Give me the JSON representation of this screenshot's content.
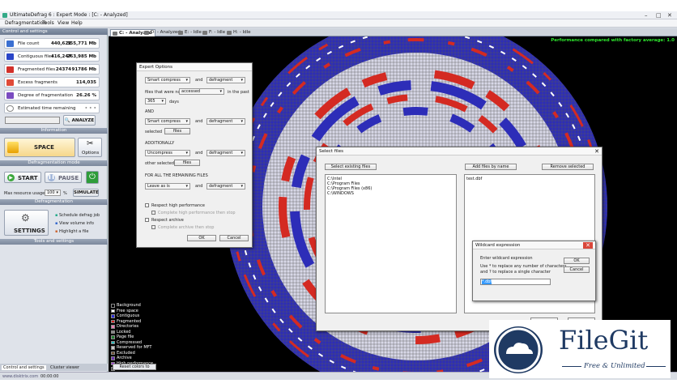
{
  "app": {
    "title": "UltimateDefrag 6  :  Expert Mode  :  [C: - Analyzed]"
  },
  "menu": [
    "Defragmentation",
    "Tools",
    "View",
    "Help"
  ],
  "left": {
    "control_header": "Control and settings",
    "stats": [
      {
        "label": "File count",
        "v1": "440,621",
        "v2": "355,771 Mb",
        "color": "#3a6fd1"
      },
      {
        "label": "Contiguous files",
        "v1": "416,247",
        "v2": "263,985 Mb",
        "color": "#2b46c8"
      },
      {
        "label": "Fragmented files",
        "v1": "24374",
        "v2": "91786 Mb",
        "color": "#d2302a"
      },
      {
        "label": "Excess fragments",
        "v1": "114,035",
        "v2": "",
        "color": "#e04a38"
      },
      {
        "label": "Degree of fragmentation",
        "v1": "26.26 %",
        "v2": "",
        "color": "#7a4bc0"
      }
    ],
    "estimated": "Estimated time remaining",
    "analyze": "ANALYZE",
    "info_footer": "Information",
    "mode_label": "SPACE",
    "options_label": "Options",
    "mode_footer": "Defragmentation mode",
    "start": "START",
    "pause": "PAUSE",
    "max_resource": "Max resource usage:",
    "max_value": "100",
    "pct": "%",
    "simulate": "SIMULATE",
    "defrag_footer": "Defragmentation",
    "settings": "SETTINGS",
    "tools": [
      "Schedule defrag job",
      "View volume info",
      "Highlight a file"
    ],
    "tools_footer": "Tools and settings",
    "bottom_tabs": [
      "Control and settings",
      "Cluster viewer"
    ]
  },
  "tabs": [
    {
      "label": "C: - Analyzed",
      "active": true
    },
    {
      "label": "D: - Analyzed",
      "active": false
    },
    {
      "label": "E: - Idle",
      "active": false
    },
    {
      "label": "F: - Idle",
      "active": false
    },
    {
      "label": "H: - Idle",
      "active": false
    }
  ],
  "perf": "Performance compared with factory average: 1.0",
  "legend": [
    {
      "label": "Background",
      "color": "#000000"
    },
    {
      "label": "Free space",
      "color": "#ffffff"
    },
    {
      "label": "Contiguous",
      "color": "#2b2bd6"
    },
    {
      "label": "Fragmented",
      "color": "#d4221f"
    },
    {
      "label": "Directories",
      "color": "#e87db0"
    },
    {
      "label": "Locked",
      "color": "#888888"
    },
    {
      "label": "Page file",
      "color": "#1d7f2d"
    },
    {
      "label": "Compressed",
      "color": "#27c0c0"
    },
    {
      "label": "Reserved for MFT",
      "color": "#c8c8c8"
    },
    {
      "label": "Excluded",
      "color": "#6b4b2a"
    },
    {
      "label": "Archive",
      "color": "#6b2fb0"
    },
    {
      "label": "High performance",
      "color": "#a33bd8"
    },
    {
      "label": "Interblock space",
      "color": "#3a3a3a"
    }
  ],
  "reset": "Reset colors to default",
  "expert": {
    "title": "Expert Options",
    "s1": "Smart compress",
    "and": "and",
    "s1b": "defragment",
    "notaccessed_pre": "files that were not",
    "notaccessed": "accessed",
    "in_past": "in the past",
    "days_val": "365",
    "days": "days",
    "and_label": "AND",
    "s2": "Smart compress",
    "s2b": "defragment",
    "selected": "selected",
    "files": "files",
    "additionally": "ADDITIONALLY",
    "s3": "Uncompress",
    "s3b": "defragment",
    "other_selected": "other selected",
    "files2": "files",
    "remaining": "FOR ALL THE REMAINING FILES",
    "s4": "Leave as is",
    "s4b": "defragment",
    "respect_hp": "Respect high performance",
    "complete_hp": "Complete high performance then stop",
    "respect_arch": "Respect archive",
    "complete_arch": "Complete archive then stop",
    "ok": "OK",
    "cancel": "Cancel"
  },
  "select": {
    "title": "Select files",
    "select_existing": "Select existing files",
    "add_by_name": "Add files by name",
    "remove": "Remove selected",
    "left_list": [
      "C:\\Intel",
      "C:\\Program Files",
      "C:\\Program Files (x86)",
      "C:\\WINDOWS"
    ],
    "right_list": [
      "test.dbf"
    ]
  },
  "wildcard": {
    "title": "Wildcard expression",
    "prompt": "Enter wildcard expression",
    "hint1": "Use * to replace any number of characters",
    "hint2": "and ? to replace a single character",
    "value": "*.dbf",
    "ok": "OK",
    "cancel": "Cancel"
  },
  "status": {
    "left": "www.disktrix.com",
    "time": "00:00:00"
  },
  "watermark": {
    "name": "FileGit",
    "tag": "Free & Unlimited"
  }
}
